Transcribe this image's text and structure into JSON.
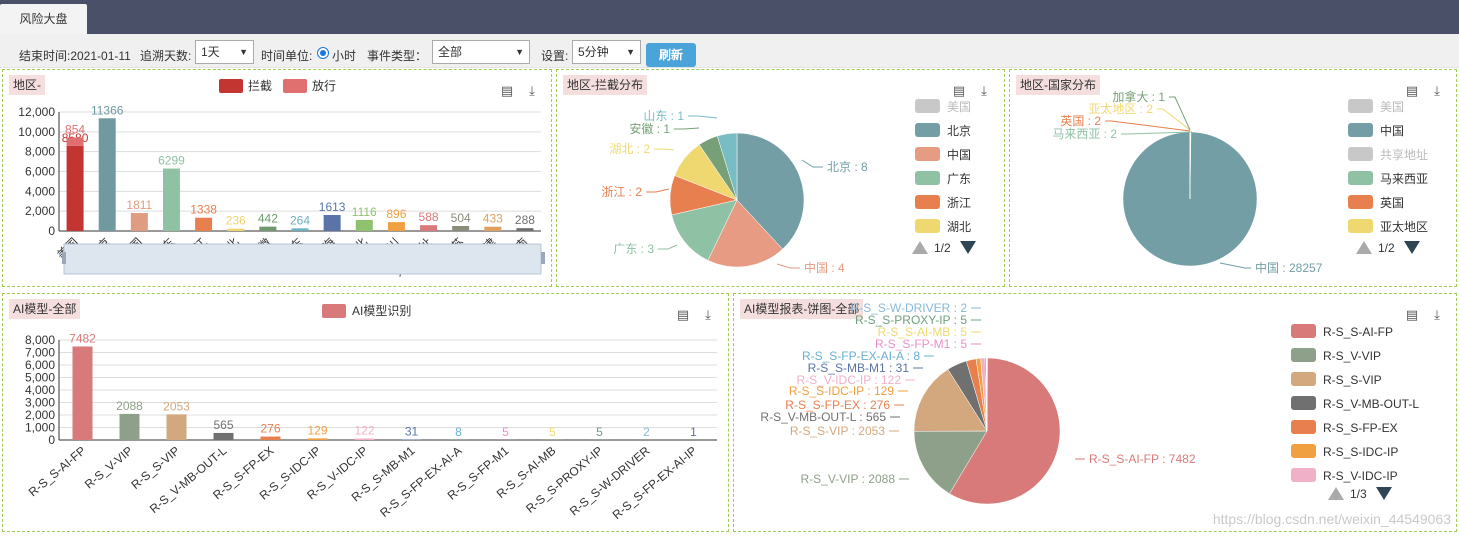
{
  "topbar": {
    "tab": "风险大盘"
  },
  "toolbar": {
    "end_time_label": "结束时间:2021-01-11",
    "lookback_label": "追溯天数:",
    "lookback_value": "1天",
    "unit_label": "时间单位:",
    "unit_option": "小时",
    "event_label": "事件类型：",
    "event_value": "全部",
    "setting_label": "设置:",
    "setting_value": "5分钟",
    "refresh": "刷新"
  },
  "colors": {
    "intercept": "#c23531",
    "release": "#e07070"
  },
  "watermark": "https://blog.csdn.net/weixin_44549063",
  "chart_data": [
    {
      "id": "region-bar",
      "title": "地区-",
      "type": "bar",
      "legend": [
        "拦截",
        "放行"
      ],
      "categories": [
        "美国",
        "北京",
        "中国",
        "广东",
        "浙江",
        "湖北",
        "安徽",
        "山东",
        "上海",
        "河北",
        "四川",
        "共享地址",
        "江苏",
        "天津",
        "河南"
      ],
      "values": [
        8580,
        11366,
        1811,
        6299,
        1338,
        236,
        442,
        264,
        1613,
        1116,
        896,
        588,
        504,
        433,
        288
      ],
      "stack_top": 854,
      "stack_top_category": "美国",
      "small_labels": [
        "0",
        "0",
        "0",
        "0",
        "0",
        "0",
        "0",
        "0"
      ],
      "colors": [
        "#c23531",
        "#6e9aa0",
        "#e09c80",
        "#8fc2a5",
        "#e87f4f",
        "#f0d46e",
        "#6e9a6e",
        "#6ab0bf",
        "#5a74a8",
        "#8fc26e",
        "#f0a040",
        "#d97a7a",
        "#8c8c7a",
        "#e0a060",
        "#707070"
      ],
      "yticks": [
        0,
        2000,
        4000,
        6000,
        8000,
        10000,
        12000
      ],
      "ytick_labels": [
        "0",
        "2,000",
        "4,000",
        "6,000",
        "8,000",
        "10,000",
        "12,000"
      ],
      "ylim": [
        0,
        12000
      ]
    },
    {
      "id": "region-pie",
      "title": "地区-拦截分布",
      "type": "pie",
      "labels": [
        "北京",
        "中国",
        "广东",
        "浙江",
        "湖北",
        "安徽",
        "山东"
      ],
      "values": [
        8,
        4,
        3,
        2,
        2,
        1,
        1
      ],
      "slice_labels": [
        "北京 : 8",
        "中国 : 4",
        "广东 : 3",
        "浙江 : 2",
        "湖北 : 2",
        "安徽 : 1",
        "山东 : 1"
      ],
      "colors": [
        "#739ea5",
        "#e69b82",
        "#8fc2a5",
        "#e87f4f",
        "#f0d870",
        "#78a078",
        "#78bcc4"
      ],
      "legend": [
        "美国",
        "北京",
        "中国",
        "广东",
        "浙江",
        "湖北"
      ],
      "legend_colors": [
        "#c8c8c8",
        "#739ea5",
        "#e69b82",
        "#8fc2a5",
        "#e87f4f",
        "#f0d870"
      ],
      "page": "1/2"
    },
    {
      "id": "country-pie",
      "title": "地区-国家分布",
      "type": "pie",
      "labels": [
        "中国",
        "马来西亚",
        "英国",
        "亚太地区",
        "加拿大"
      ],
      "values": [
        28257,
        2,
        2,
        2,
        1
      ],
      "slice_labels": [
        "中国 : 28257",
        "马来西亚 : 2",
        "英国 : 2",
        "亚太地区 : 2",
        "加拿大 : 1"
      ],
      "colors": [
        "#739ea5",
        "#8fc2a5",
        "#e87f4f",
        "#f0d870",
        "#78a078"
      ],
      "legend": [
        "美国",
        "中国",
        "共享地址",
        "马来西亚",
        "英国",
        "亚太地区"
      ],
      "legend_colors": [
        "#c8c8c8",
        "#739ea5",
        "#c8c8c8",
        "#8fc2a5",
        "#e87f4f",
        "#f0d870"
      ],
      "page": "1/2"
    },
    {
      "id": "ai-bar",
      "title": "AI模型-全部",
      "type": "bar",
      "legend": [
        "AI模型识别"
      ],
      "categories": [
        "R-S_S-AI-FP",
        "R-S_V-VIP",
        "R-S_S-VIP",
        "R-S_V-MB-OUT-L",
        "R-S_S-FP-EX",
        "R-S_S-IDC-IP",
        "R-S_V-IDC-IP",
        "R-S_S-MB-M1",
        "R-S_S-FP-EX-AI-A",
        "R-S_S-FP-M1",
        "R-S_S-AI-MB",
        "R-S_S-PROXY-IP",
        "R-S_S-W-DRIVER",
        "R-S_S-FP-EX-AI-IP"
      ],
      "values": [
        7482,
        2088,
        2053,
        565,
        276,
        129,
        122,
        31,
        8,
        5,
        5,
        5,
        2,
        1
      ],
      "colors": [
        "#d97a7a",
        "#8fa08a",
        "#d4a87e",
        "#707070",
        "#e87f4f",
        "#f0a040",
        "#f0b0c8",
        "#5a74a8",
        "#6ab0d0",
        "#e890c8",
        "#f0d870",
        "#70a080",
        "#88b8d8",
        "#5a74a8"
      ],
      "yticks": [
        0,
        1000,
        2000,
        3000,
        4000,
        5000,
        6000,
        7000,
        8000
      ],
      "ytick_labels": [
        "0",
        "1,000",
        "2,000",
        "3,000",
        "4,000",
        "5,000",
        "6,000",
        "7,000",
        "8,000"
      ],
      "ylim": [
        0,
        8000
      ]
    },
    {
      "id": "ai-pie",
      "title": "AI模型报表-饼图-全部",
      "type": "pie",
      "labels": [
        "R-S_S-AI-FP",
        "R-S_V-VIP",
        "R-S_S-VIP",
        "R-S_V-MB-OUT-L",
        "R-S_S-FP-EX",
        "R-S_S-IDC-IP",
        "R-S_V-IDC-IP",
        "R-S_S-MB-M1",
        "R-S_S-FP-EX-AI-A",
        "R-S_S-FP-M1",
        "R-S_S-AI-MB",
        "R-S_S-PROXY-IP",
        "R-S_S-W-DRIVER"
      ],
      "values": [
        7482,
        2088,
        2053,
        565,
        276,
        129,
        122,
        31,
        8,
        5,
        5,
        5,
        2
      ],
      "slice_labels": [
        "R-S_S-AI-FP : 7482",
        "R-S_V-VIP : 2088",
        "R-S_S-VIP : 2053",
        "R-S_V-MB-OUT-L : 565",
        "R-S_S-FP-EX : 276",
        "R-S_S-IDC-IP : 129",
        "R-S_V-IDC-IP : 122",
        "R-S_S-MB-M1 : 31",
        "R-S_S-FP-EX-AI-A : 8",
        "R-S_S-FP-M1 : 5",
        "R-S_S-AI-MB : 5",
        "R-S_S-PROXY-IP : 5",
        "R-S_S-W-DRIVER : 2"
      ],
      "colors": [
        "#d97a7a",
        "#8fa08a",
        "#d4a87e",
        "#707070",
        "#e87f4f",
        "#f0a040",
        "#f0b0c8",
        "#5a74a8",
        "#6ab0d0",
        "#e890c8",
        "#f0d870",
        "#70a080",
        "#88b8d8"
      ],
      "legend": [
        "R-S_S-AI-FP",
        "R-S_V-VIP",
        "R-S_S-VIP",
        "R-S_V-MB-OUT-L",
        "R-S_S-FP-EX",
        "R-S_S-IDC-IP",
        "R-S_V-IDC-IP"
      ],
      "legend_colors": [
        "#d97a7a",
        "#8fa08a",
        "#d4a87e",
        "#707070",
        "#e87f4f",
        "#f0a040",
        "#f0b0c8"
      ],
      "page": "1/3"
    }
  ]
}
